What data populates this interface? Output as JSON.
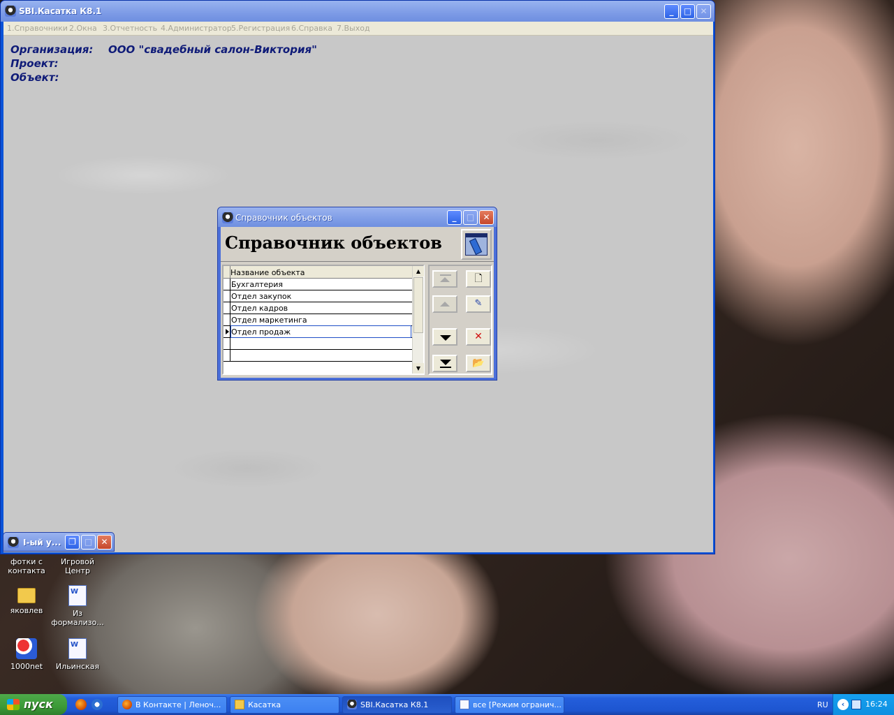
{
  "main_window": {
    "title": "SBI.Касатка К8.1",
    "menu": [
      "1.Справочники",
      "2.Окна",
      "3.Отчетность",
      "4.Администратор",
      "5.Регистрация",
      "6.Справка",
      "7.Выход"
    ],
    "labels": {
      "organization": "Организация:",
      "organization_value": "ООО \"свадебный салон-Виктория\"",
      "project": "Проект:",
      "object": "Объект:"
    }
  },
  "dialog": {
    "title": "Справочник объектов",
    "heading": "Справочник объектов",
    "grid": {
      "column_header": "Название объекта",
      "rows": [
        "Бухгалтерия",
        "Отдел закупок",
        "Отдел кадров",
        "Отдел маркетинга",
        "Отдел продаж",
        "",
        ""
      ],
      "current_row": "Отдел продаж"
    },
    "buttons": {
      "first": "first-record",
      "prev": "previous-record",
      "next": "next-record",
      "last": "last-record",
      "new": "new-document",
      "edit": "edit-record",
      "delete": "delete-record",
      "open": "open-folder"
    }
  },
  "minimized_window": {
    "title": "І-ый у..."
  },
  "desktop": {
    "icons": [
      {
        "label_line1": "фотки с",
        "label_line2": "контакта",
        "icon": "shortcut"
      },
      {
        "label_line1": "Игровой",
        "label_line2": "Центр",
        "icon": "shortcut"
      },
      {
        "label_line1": "яковлев",
        "label_line2": "",
        "icon": "folder-icon"
      },
      {
        "label_line1": "Из",
        "label_line2": "формализо...",
        "icon": "word-document-icon"
      },
      {
        "label_line1": "1000net",
        "label_line2": "",
        "icon": "game-icon"
      },
      {
        "label_line1": "Ильинская",
        "label_line2": "",
        "icon": "word-document-icon"
      }
    ]
  },
  "taskbar": {
    "start_label": "пуск",
    "tasks": [
      {
        "label": "В Контакте | Леноч...",
        "icon": "firefox-icon"
      },
      {
        "label": "Касатка",
        "icon": "folder-icon"
      },
      {
        "label": "SBI.Касатка К8.1",
        "icon": "app-icon"
      },
      {
        "label": "все [Режим огранич...",
        "icon": "word-document-icon"
      }
    ],
    "language": "RU",
    "clock": "16:24"
  },
  "colors": {
    "title_bar": "#7d9be6",
    "info_text": "#0f1b78",
    "client_bg": "#c8c8c8",
    "taskbar": "#245edb",
    "start_button": "#3c9a37"
  }
}
